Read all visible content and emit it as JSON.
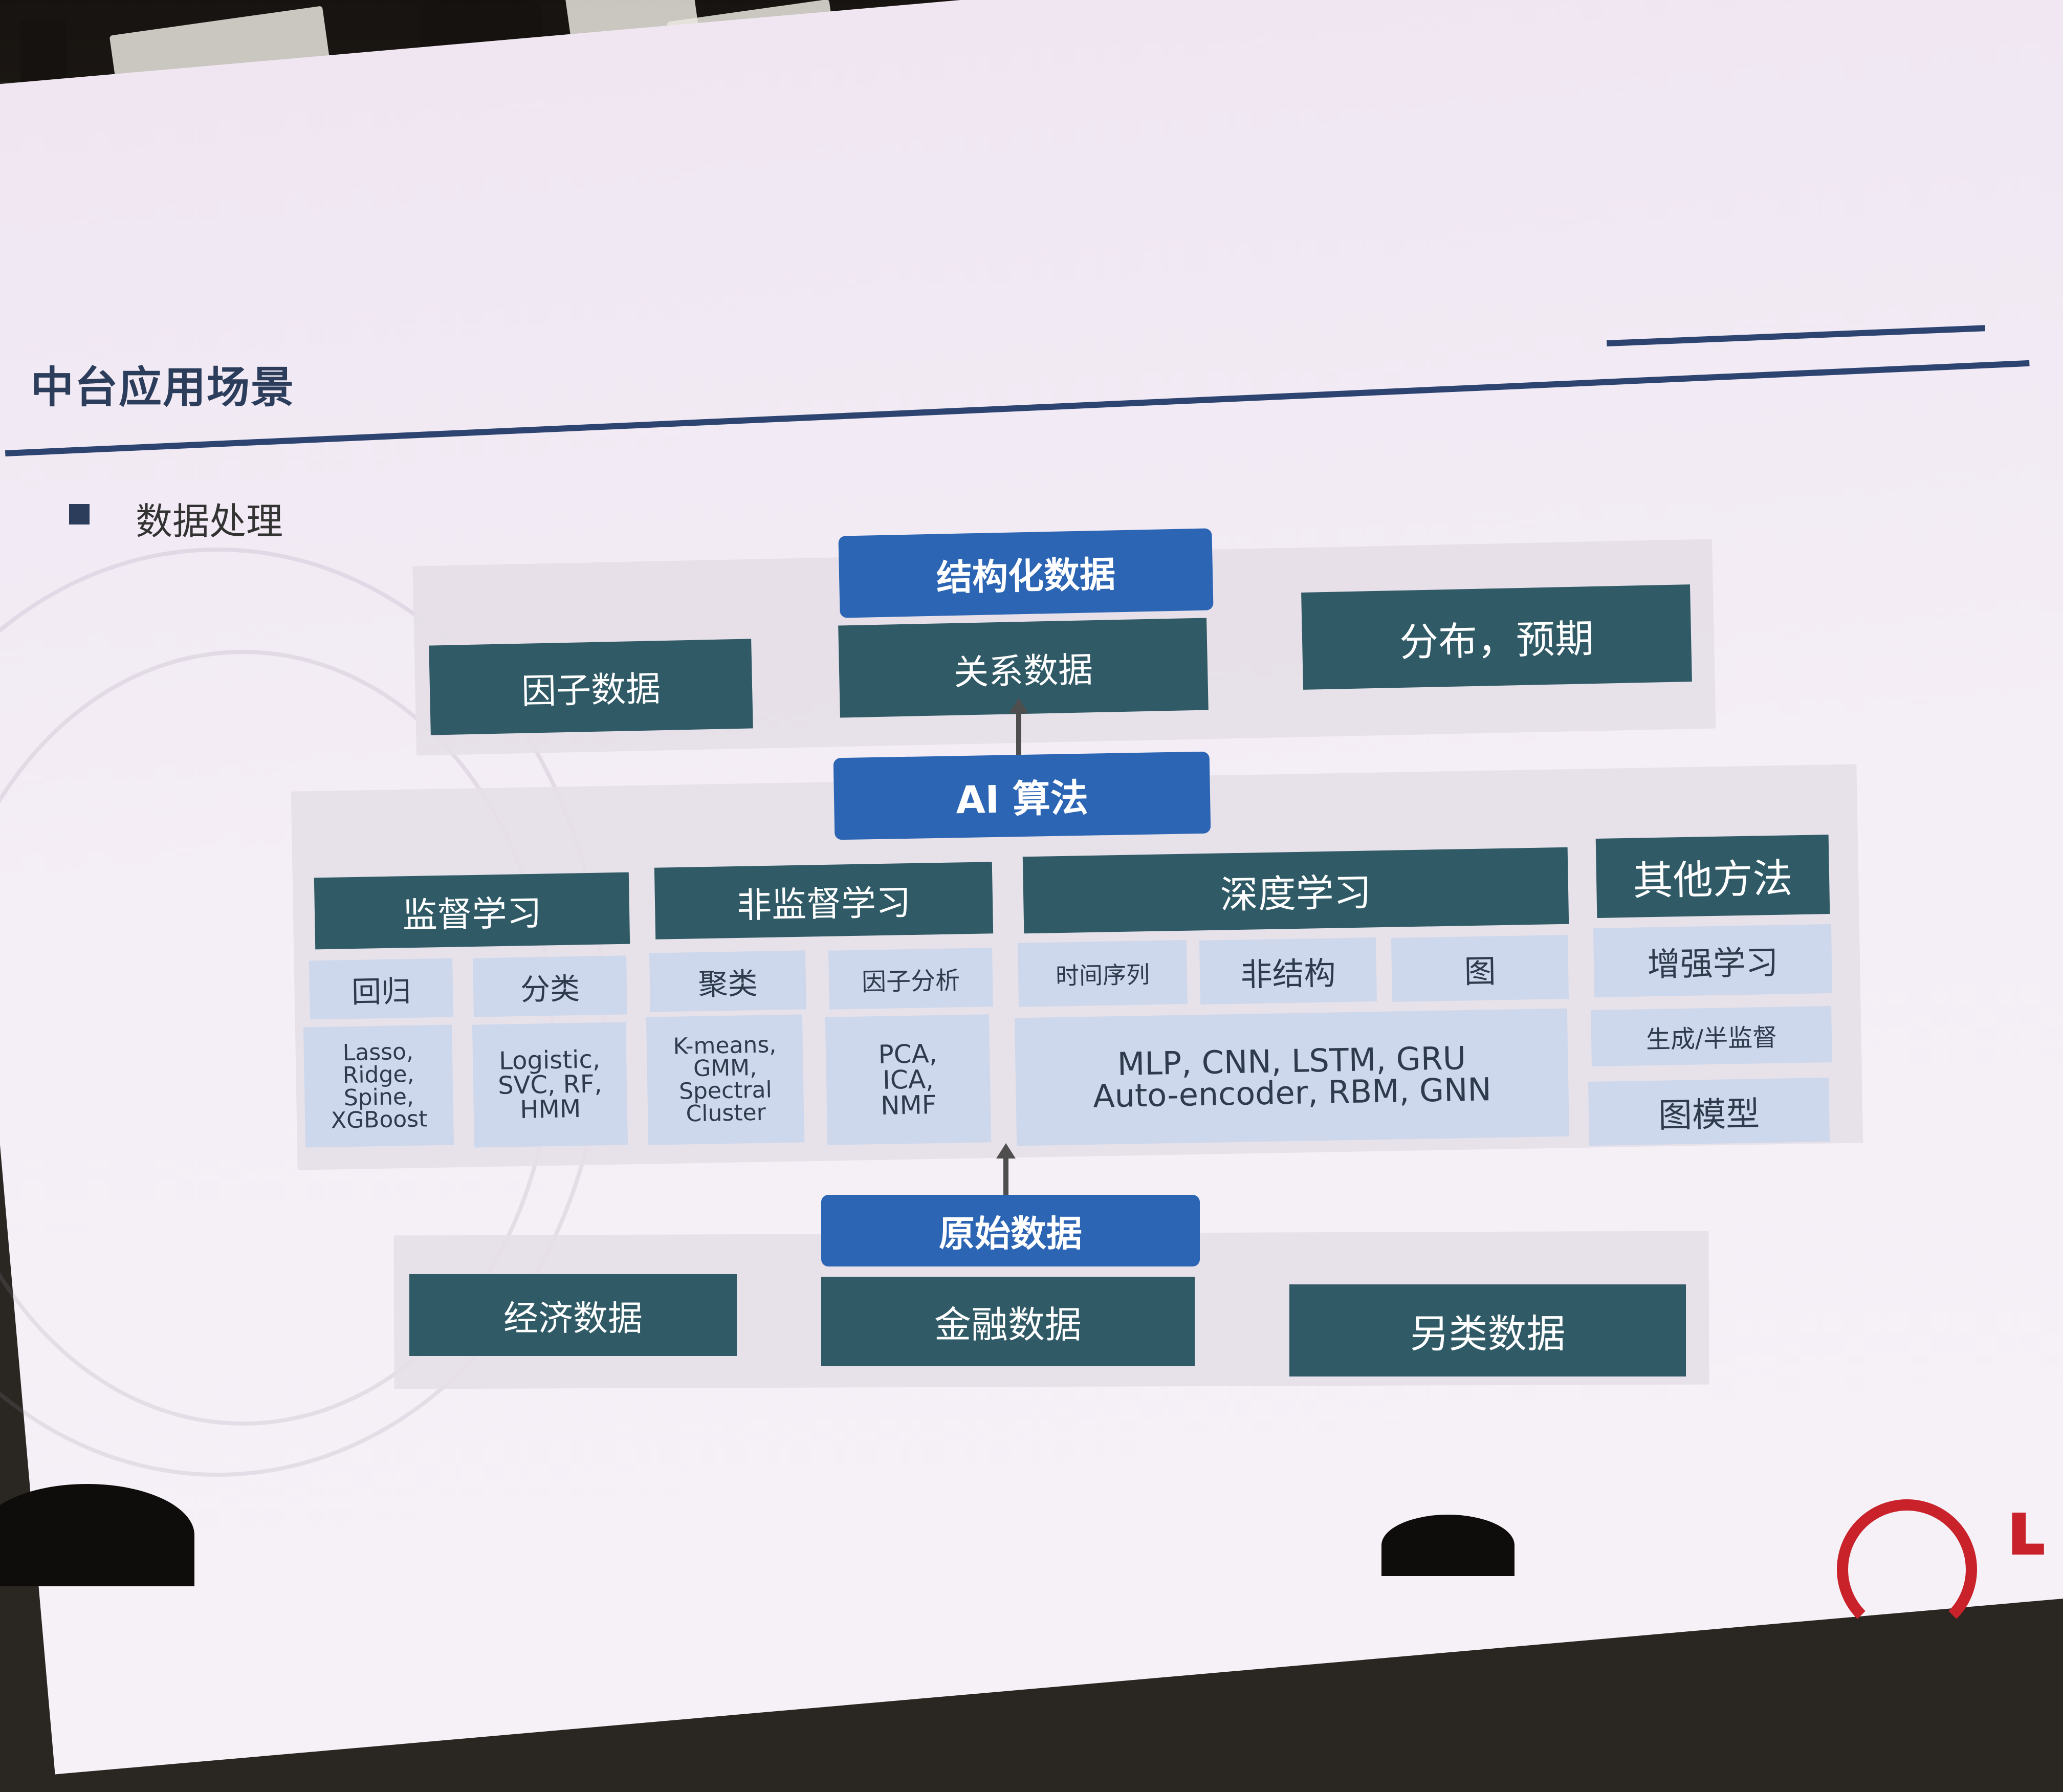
{
  "slide": {
    "title": "中台应用场景",
    "bullet": "数据处理",
    "structured": {
      "header": "结构化数据",
      "items": [
        "因子数据",
        "关系数据",
        "分布，预期"
      ]
    },
    "ai": {
      "header": "AI 算法",
      "groups": {
        "supervised": {
          "label": "监督学习",
          "sub": [
            "回归",
            "分类"
          ],
          "methods": [
            [
              "Lasso,",
              "Ridge,",
              "Spine,",
              "XGBoost"
            ],
            [
              "Logistic,",
              "SVC, RF,",
              "HMM"
            ]
          ]
        },
        "unsupervised": {
          "label": "非监督学习",
          "sub": [
            "聚类",
            "因子分析"
          ],
          "methods": [
            [
              "K-means,",
              "GMM,",
              "Spectral",
              "Cluster"
            ],
            [
              "PCA,",
              "ICA,",
              "NMF"
            ]
          ]
        },
        "deep": {
          "label": "深度学习",
          "sub": [
            "时间序列",
            "非结构",
            "图"
          ],
          "methods": [
            "MLP, CNN, LSTM, GRU",
            "Auto-encoder, RBM, GNN"
          ]
        },
        "other": {
          "label": "其他方法",
          "items": [
            "增强学习",
            "生成/半监督",
            "图模型"
          ]
        }
      }
    },
    "raw": {
      "header": "原始数据",
      "items": [
        "经济数据",
        "金融数据",
        "另类数据"
      ]
    },
    "logo_text": "ʟ"
  },
  "colors": {
    "dark_box": "#2f5a66",
    "blue_header": "#2c65b4",
    "light_cell": "#cdd8ec",
    "title_rule": "#2d4470",
    "logo_red": "#c9222a"
  }
}
